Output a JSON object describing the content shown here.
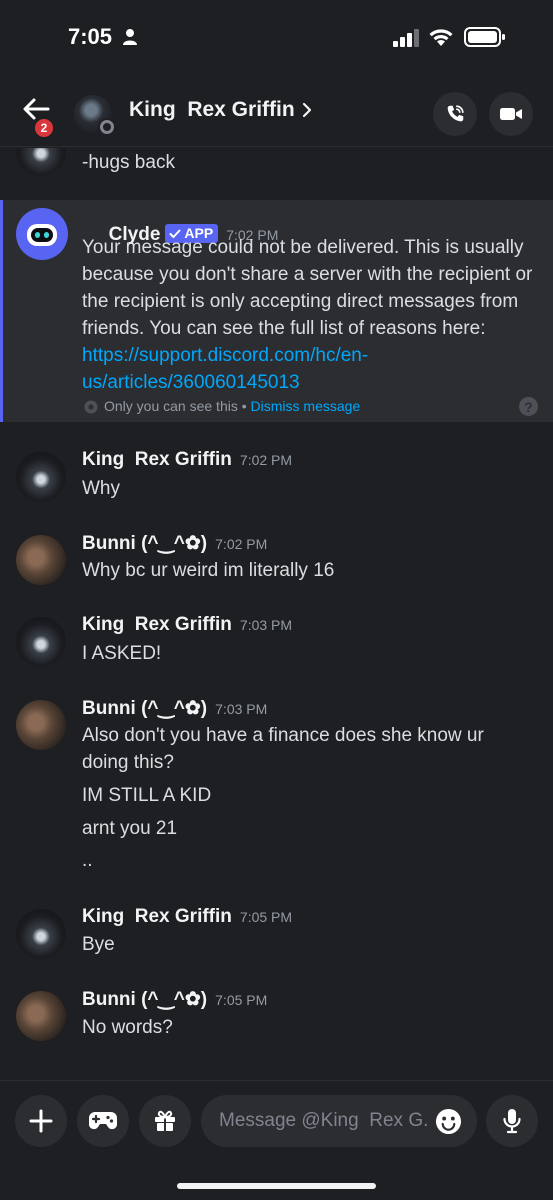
{
  "status_bar": {
    "time": "7:05"
  },
  "header": {
    "back_badge": "2",
    "title": "King  Rex Griffin"
  },
  "messages": {
    "partial_text": "-hugs back",
    "clyde": {
      "author": "Clyde",
      "badge": "APP",
      "time": "7:02 PM",
      "text_before_link": "Your message could not be delivered. This is usually because you don't share a server with the recipient or the recipient is only accepting direct messages from friends. You can see the full list of reasons here: ",
      "link": "https://support.discord.com/hc/en-us/articles/360060145013",
      "only_you": "Only you can see this",
      "separator": " • ",
      "dismiss": "Dismiss message"
    },
    "items": [
      {
        "author": "King  Rex Griffin",
        "time": "7:02 PM",
        "lines": [
          "Why"
        ]
      },
      {
        "author": "Bunni (^‿^✿)",
        "time": "7:02 PM",
        "lines": [
          "Why bc ur weird im literally 16"
        ]
      },
      {
        "author": "King  Rex Griffin",
        "time": "7:03 PM",
        "lines": [
          "I ASKED!"
        ]
      },
      {
        "author": "Bunni (^‿^✿)",
        "time": "7:03 PM",
        "lines": [
          "Also don't you have a finance does she know ur",
          "doing this?",
          "IM STILL A KID",
          "arnt you 21",
          ".."
        ]
      },
      {
        "author": "King  Rex Griffin",
        "time": "7:05 PM",
        "lines": [
          "Bye"
        ]
      },
      {
        "author": "Bunni (^‿^✿)",
        "time": "7:05 PM",
        "lines": [
          "No words?"
        ]
      }
    ]
  },
  "composer": {
    "placeholder": "Message @King  Rex G.."
  }
}
